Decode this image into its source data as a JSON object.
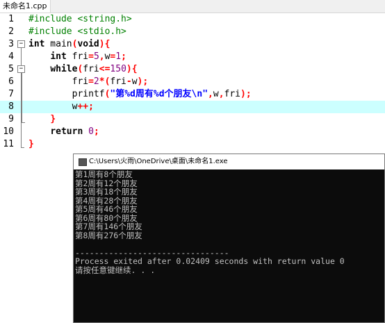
{
  "tab": {
    "label": "未命名1.cpp"
  },
  "editor": {
    "line_numbers": [
      "1",
      "2",
      "3",
      "4",
      "5",
      "6",
      "7",
      "8",
      "9",
      "10",
      "11"
    ],
    "lines": [
      [
        {
          "t": "#include <string.h>",
          "c": "pp"
        }
      ],
      [
        {
          "t": "#include <stdio.h>",
          "c": "pp"
        }
      ],
      [
        {
          "t": "int",
          "c": "kw"
        },
        {
          "t": " main",
          "c": ""
        },
        {
          "t": "(",
          "c": "pn"
        },
        {
          "t": "void",
          "c": "kw"
        },
        {
          "t": "){",
          "c": "pn"
        }
      ],
      [
        {
          "t": "    ",
          "c": ""
        },
        {
          "t": "int",
          "c": "kw"
        },
        {
          "t": " fri",
          "c": ""
        },
        {
          "t": "=",
          "c": "op"
        },
        {
          "t": "5",
          "c": "num"
        },
        {
          "t": ",",
          "c": "op"
        },
        {
          "t": "w",
          "c": ""
        },
        {
          "t": "=",
          "c": "op"
        },
        {
          "t": "1",
          "c": "num"
        },
        {
          "t": ";",
          "c": "op"
        }
      ],
      [
        {
          "t": "    ",
          "c": ""
        },
        {
          "t": "while",
          "c": "kw"
        },
        {
          "t": "(",
          "c": "pn"
        },
        {
          "t": "fri",
          "c": ""
        },
        {
          "t": "<=",
          "c": "op"
        },
        {
          "t": "150",
          "c": "num"
        },
        {
          "t": "){",
          "c": "pn"
        }
      ],
      [
        {
          "t": "        fri",
          "c": ""
        },
        {
          "t": "=",
          "c": "op"
        },
        {
          "t": "2",
          "c": "num"
        },
        {
          "t": "*(",
          "c": "op"
        },
        {
          "t": "fri",
          "c": ""
        },
        {
          "t": "-",
          "c": "op"
        },
        {
          "t": "w",
          "c": ""
        },
        {
          "t": ");",
          "c": "op"
        }
      ],
      [
        {
          "t": "        printf",
          "c": ""
        },
        {
          "t": "(",
          "c": "pn"
        },
        {
          "t": "\"第%d周有%d个朋友\\n\"",
          "c": "str"
        },
        {
          "t": ",",
          "c": "op"
        },
        {
          "t": "w",
          "c": ""
        },
        {
          "t": ",",
          "c": "op"
        },
        {
          "t": "fri",
          "c": ""
        },
        {
          "t": ");",
          "c": "op"
        }
      ],
      [
        {
          "t": "        w",
          "c": ""
        },
        {
          "t": "++;",
          "c": "op"
        }
      ],
      [
        {
          "t": "    ",
          "c": ""
        },
        {
          "t": "}",
          "c": "pn"
        }
      ],
      [
        {
          "t": "    ",
          "c": ""
        },
        {
          "t": "return",
          "c": "kw"
        },
        {
          "t": " ",
          "c": ""
        },
        {
          "t": "0",
          "c": "num"
        },
        {
          "t": ";",
          "c": "op"
        }
      ],
      [
        {
          "t": "}",
          "c": "pn"
        }
      ]
    ],
    "highlighted_line": 8
  },
  "console": {
    "title": "C:\\Users\\火雨\\OneDrive\\桌面\\未命名1.exe",
    "output": [
      "第1周有8个朋友",
      "第2周有12个朋友",
      "第3周有18个朋友",
      "第4周有28个朋友",
      "第5周有46个朋友",
      "第6周有80个朋友",
      "第7周有146个朋友",
      "第8周有276个朋友",
      "",
      "--------------------------------",
      "Process exited after 0.02409 seconds with return value 0",
      "请按任意键继续. . ."
    ]
  },
  "colors": {
    "highlight_line": "#ccffff",
    "preprocessor": "#008000",
    "number": "#800080",
    "string": "#0000ff",
    "operator": "#ff0000",
    "console_bg": "#0c0c0c",
    "console_fg": "#c0c0c0"
  }
}
